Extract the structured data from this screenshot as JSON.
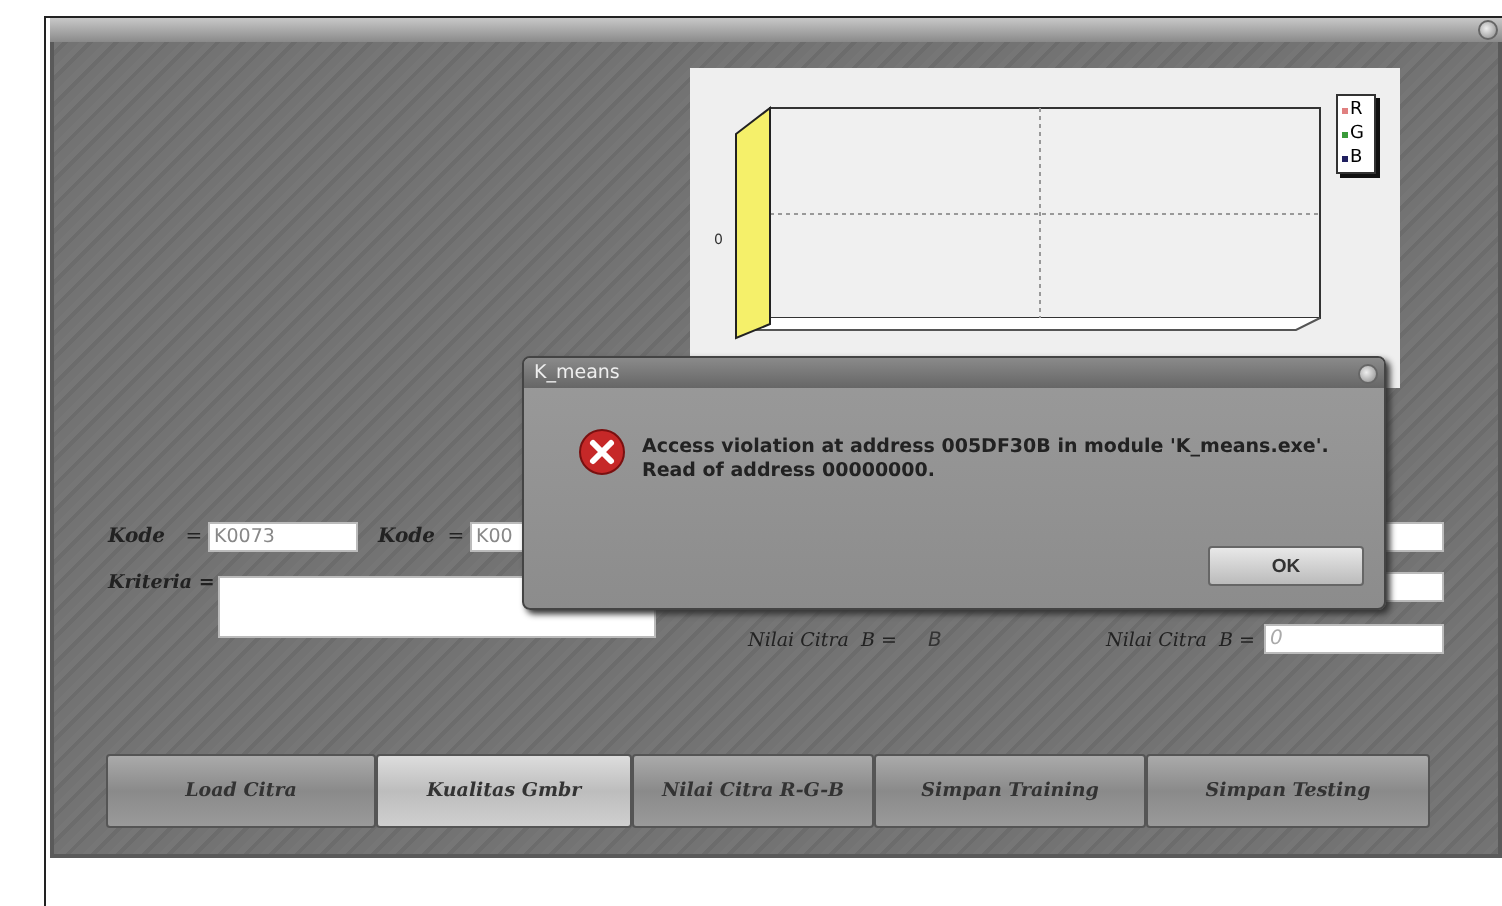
{
  "chart": {
    "y_tick": "0",
    "legend": [
      {
        "label": "R",
        "color": "#e08080"
      },
      {
        "label": "G",
        "color": "#3a9a3a"
      },
      {
        "label": "B",
        "color": "#202060"
      }
    ]
  },
  "form": {
    "kode_1": {
      "label": "Kode",
      "equals": "=",
      "value": "K0073"
    },
    "kode_2": {
      "label": "Kode",
      "equals": "=",
      "value": "K00"
    },
    "kriteria": {
      "label": "Kriteria ="
    },
    "nilai_rows": [
      {
        "kind": "field"
      },
      {
        "kind": "field"
      },
      {
        "kind": "labeled",
        "label_1": "Nilai Citra  B =",
        "value_1": "B",
        "label_2": "Nilai Citra  B =",
        "value": "0"
      }
    ]
  },
  "buttons": [
    {
      "label": "Load Citra",
      "selected": false
    },
    {
      "label": "Kualitas Gmbr",
      "selected": true
    },
    {
      "label": "Nilai Citra R-G-B",
      "selected": false
    },
    {
      "label": "Simpan Training",
      "selected": false
    },
    {
      "label": "Simpan Testing",
      "selected": false
    }
  ],
  "dialog": {
    "title": "K_means",
    "message": "Access violation at address 005DF30B in module 'K_means.exe'. Read of address 00000000.",
    "button": "OK"
  }
}
